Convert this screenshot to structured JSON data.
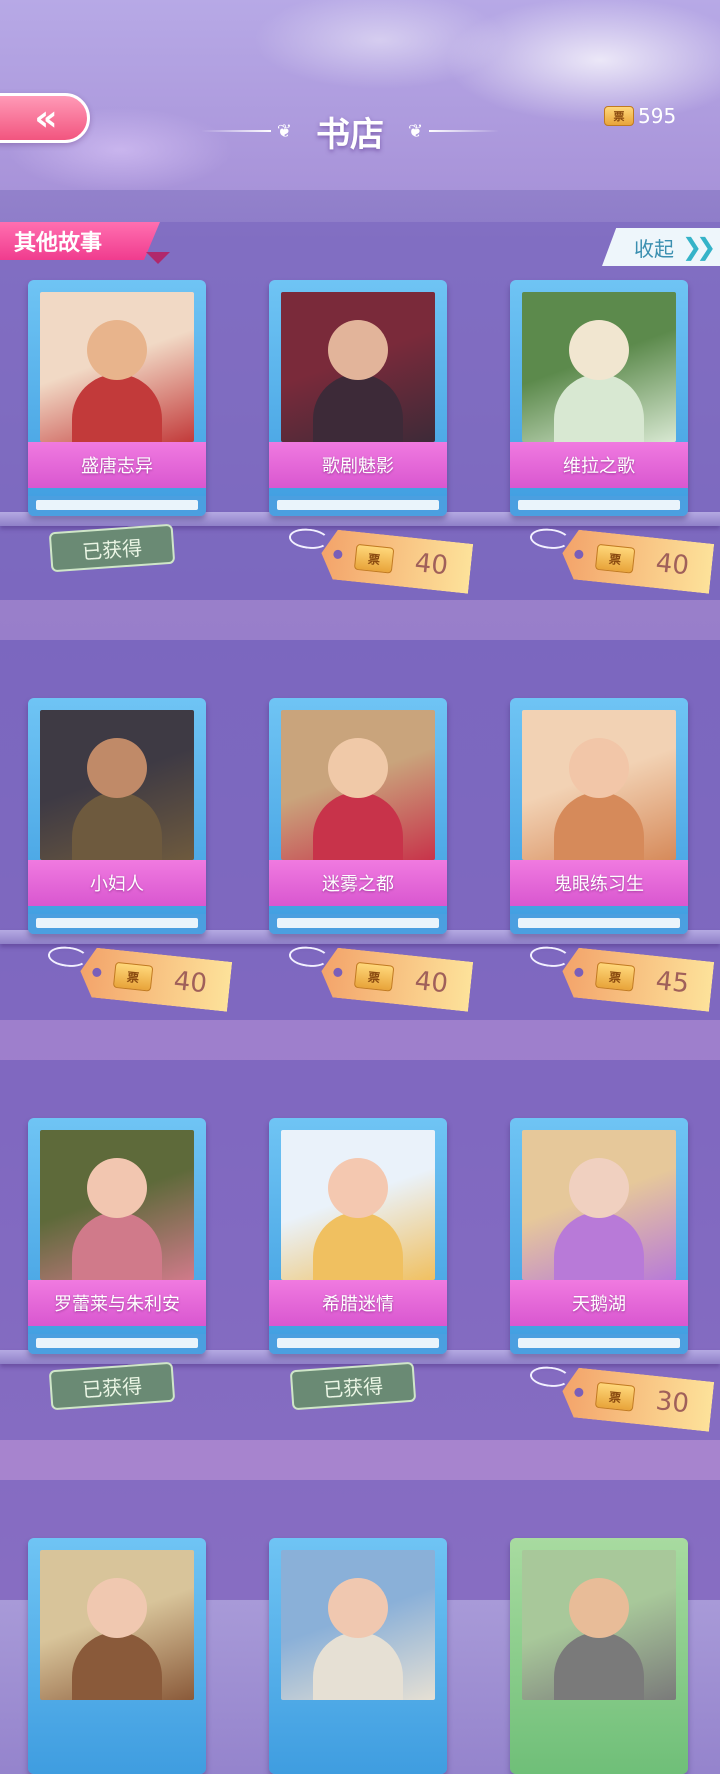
{
  "header": {
    "back_label": "«",
    "title": "书店",
    "currency": {
      "icon": "ticket-icon",
      "value": "595"
    }
  },
  "section": {
    "tag": "其他故事",
    "collapse_label": "收起",
    "collapse_icon": "double-chevron-right-icon"
  },
  "ticket_glyph": "票",
  "owned_label": "已获得",
  "books": [
    {
      "title": "盛唐志异",
      "status": "owned",
      "price": "",
      "palette": [
        "#f1d9c5",
        "#e8b48c",
        "#c23a3a"
      ]
    },
    {
      "title": "歌剧魅影",
      "status": "price",
      "price": "40",
      "palette": [
        "#7a2a3a",
        "#e2b49a",
        "#3d2a38"
      ]
    },
    {
      "title": "维拉之歌",
      "status": "price",
      "price": "40",
      "palette": [
        "#5c8a4c",
        "#f1e6d0",
        "#d8e8d2"
      ]
    },
    {
      "title": "小妇人",
      "status": "price",
      "price": "40",
      "palette": [
        "#3e3a44",
        "#c08a68",
        "#6e5a3e"
      ]
    },
    {
      "title": "迷雾之都",
      "status": "price",
      "price": "40",
      "palette": [
        "#c9a47c",
        "#f0c9a8",
        "#c8334a"
      ]
    },
    {
      "title": "鬼眼练习生",
      "status": "price",
      "price": "45",
      "palette": [
        "#f2d2b4",
        "#f2c6a8",
        "#d68a5a"
      ]
    },
    {
      "title": "罗蕾莱与朱利安",
      "status": "owned",
      "price": "",
      "palette": [
        "#5e6a3a",
        "#f2c6b0",
        "#d07a8a"
      ]
    },
    {
      "title": "希腊迷情",
      "status": "owned",
      "price": "",
      "palette": [
        "#eaf2fa",
        "#f4c8b0",
        "#f0c060"
      ]
    },
    {
      "title": "天鹅湖",
      "status": "price",
      "price": "30",
      "palette": [
        "#e6c89a",
        "#f0d0c0",
        "#b87ad8"
      ]
    },
    {
      "title": "",
      "status": "none",
      "price": "",
      "palette": [
        "#d8c49a",
        "#f0c8b0",
        "#8a5a3a"
      ]
    },
    {
      "title": "",
      "status": "none",
      "price": "",
      "palette": [
        "#8ab0d8",
        "#f0c8b0",
        "#e6e0d4"
      ]
    },
    {
      "title": "",
      "status": "none",
      "price": "",
      "palette": [
        "#a8c89a",
        "#e8bc98",
        "#7a7a7a"
      ]
    }
  ]
}
